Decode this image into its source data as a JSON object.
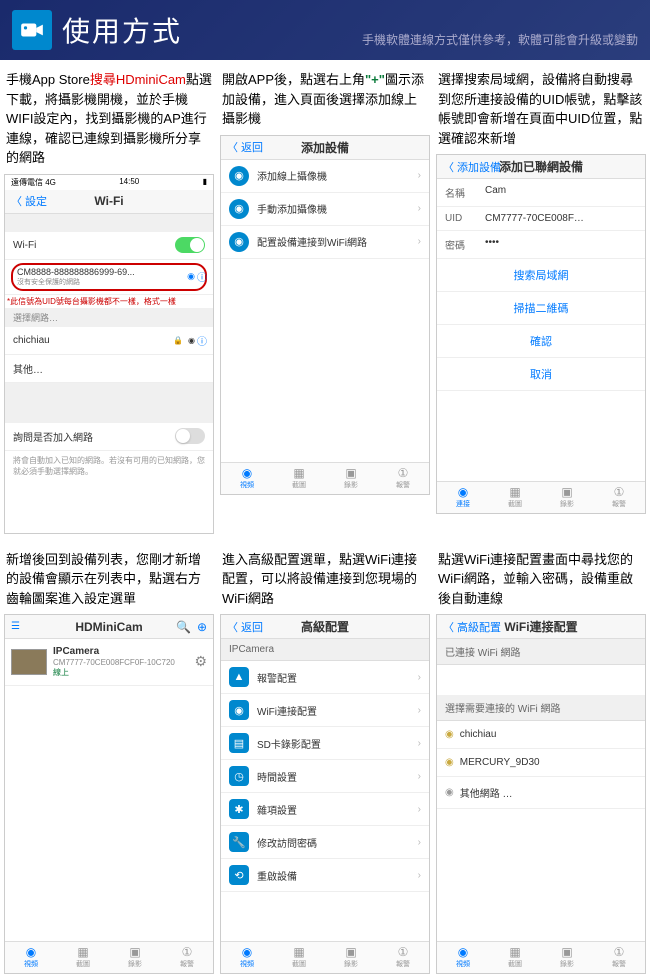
{
  "header": {
    "title": "使用方式",
    "subtitle": "手機軟體連線方式僅供參考，軟體可能會升級或變動"
  },
  "row1": {
    "col1": {
      "desc_pre": "手機App Store",
      "desc_red": "搜尋HDminiCam",
      "desc_post": "點選下載，將攝影機開機，並於手機WIFI設定內，找到攝影機的AP進行連線，確認已連線到攝影機所分享的網路",
      "status_left": "遠傳電信 4G",
      "status_time": "14:50",
      "nav_back": "〈 設定",
      "nav_title": "Wi-Fi",
      "wifi_label": "Wi-Fi",
      "ssid": "CM8888-888888886999-69...",
      "ssid_sub": "沒有安全保護的網路",
      "red_note": "*此信號為UID號每台攝影機都不一樣，格式一樣",
      "section_choose": "選擇網路…",
      "net1": "chichiau",
      "net2": "其他…",
      "ask_join": "詢問是否加入網路",
      "ask_note": "將會自動加入已知的網路。若沒有可用的已知網路，您就必須手動選擇網路。"
    },
    "col2": {
      "desc_pre": "開啟APP後，點選右上角",
      "desc_green": "\"+\"",
      "desc_post": "圖示添加設備，進入頁面後選擇添加線上攝影機",
      "nav_back": "〈 返回",
      "nav_title": "添加設備",
      "item1": "添加線上攝像機",
      "item2": "手動添加攝像機",
      "item3": "配置設備連接到WiFi網路",
      "tab1": "視頻",
      "tab2": "截圖",
      "tab3": "錄影",
      "tab4": "報警"
    },
    "col3": {
      "desc": "選擇搜索局域網，設備將自動搜尋到您所連接設備的UID帳號，點擊該帳號即會新增在頁面中UID位置，點選確認來新增",
      "nav_back": "〈 添加設備",
      "nav_title": "添加已聯網設備",
      "f_name_label": "名稱",
      "f_name_val": "Cam",
      "f_uid_label": "UID",
      "f_uid_val": "CM7777-70CE008F…",
      "f_pwd_label": "密碼",
      "f_pwd_val": "••••",
      "btn1": "搜索局域網",
      "btn2": "掃描二維碼",
      "btn3": "確認",
      "btn4": "取消",
      "tab1": "連接",
      "tab2": "截圖",
      "tab3": "錄影",
      "tab4": "報警"
    }
  },
  "row2": {
    "col1": {
      "desc": "新增後回到設備列表，您剛才新增的設備會顯示在列表中，點選右方齒輪圖案進入設定選單",
      "nav_title": "HDMiniCam",
      "cam_name": "IPCamera",
      "cam_uid": "CM7777-70CE008FCF0F-10C720",
      "cam_status": "線上",
      "tab1": "視頻",
      "tab2": "截圖",
      "tab3": "錄影",
      "tab4": "報警"
    },
    "col2": {
      "desc": "進入高級配置選單，點選WiFi連接配置，可以將設備連接到您現場的WiFi網路",
      "nav_back": "〈 返回",
      "nav_title": "高級配置",
      "sub": "IPCamera",
      "i1": "報警配置",
      "i2": "WiFi連接配置",
      "i3": "SD卡錄影配置",
      "i4": "時間設置",
      "i5": "雜項設置",
      "i6": "修改訪問密碼",
      "i7": "重啟設備",
      "tab1": "視頻",
      "tab2": "截圖",
      "tab3": "錄影",
      "tab4": "報警"
    },
    "col3": {
      "desc": "點選WiFi連接配置畫面中尋找您的WiFi網路，並輸入密碼，設備重啟後自動連線",
      "nav_back": "〈 高級配置",
      "nav_title": "WiFi連接配置",
      "connected": "已連接 WiFi 網路",
      "choose": "選擇需要連接的 WiFi 網路",
      "w1": "chichiau",
      "w2": "MERCURY_9D30",
      "w3": "其他網路 …",
      "tab1": "視頻",
      "tab2": "截圖",
      "tab3": "錄影",
      "tab4": "報警"
    }
  }
}
